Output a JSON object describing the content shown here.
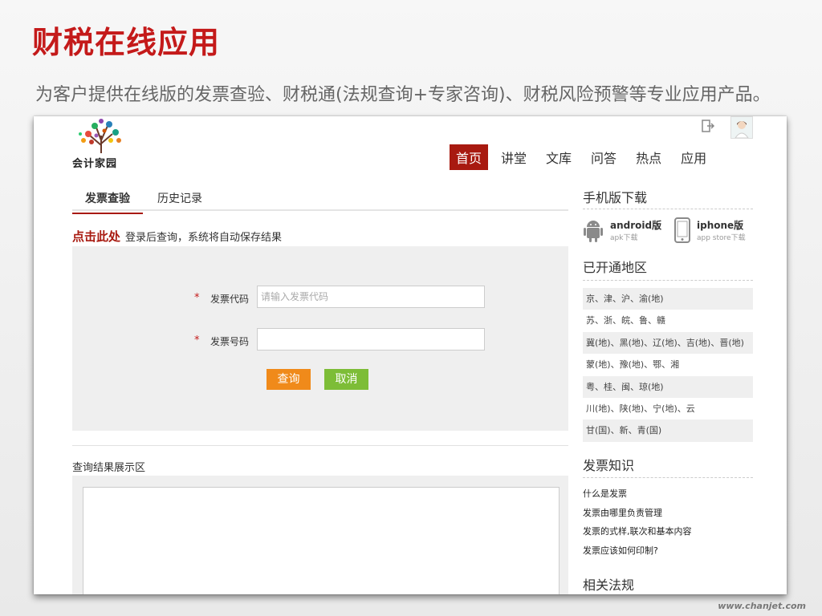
{
  "slide": {
    "title": "财税在线应用",
    "subtitle": "为客户提供在线版的发票查验、财税通(法规查询+专家咨询)、财税风险预警等专业应用产品。",
    "footer": "www.chanjet.com",
    "title_color": "#c41a1a"
  },
  "site": {
    "logo_text": "会计家园",
    "nav": [
      "首页",
      "讲堂",
      "文库",
      "问答",
      "热点",
      "应用"
    ],
    "accent": "#a81a10",
    "tabs": [
      "发票查验",
      "历史记录"
    ],
    "login_link": "点击此处",
    "login_hint": "登录后查询，系统将自动保存结果",
    "form": {
      "required_mark": "*",
      "code_label": "发票代码",
      "code_placeholder": "请输入发票代码",
      "number_label": "发票号码",
      "number_value": "",
      "query_button": "查询",
      "cancel_button": "取消"
    },
    "result_title": "查询结果展示区"
  },
  "sidebar": {
    "download_title": "手机版下载",
    "downloads": [
      {
        "name": "android版",
        "sub": "apk下载",
        "icon": "android-icon"
      },
      {
        "name": "iphone版",
        "sub": "app store下载",
        "icon": "iphone-icon"
      }
    ],
    "regions_title": "已开通地区",
    "regions": [
      "京、津、沪、渝(地)",
      "苏、浙、皖、鲁、赣",
      "冀(地)、黑(地)、辽(地)、吉(地)、晋(地)",
      "蒙(地)、豫(地)、鄂、湘",
      "粤、桂、闽、琼(地)",
      "川(地)、陕(地)、宁(地)、云",
      "甘(国)、新、青(国)"
    ],
    "knowledge_title": "发票知识",
    "knowledge": [
      "什么是发票",
      "发票由哪里负责管理",
      "发票的式样,联次和基本内容",
      "发票应该如何印制?"
    ],
    "law_title": "相关法规"
  }
}
